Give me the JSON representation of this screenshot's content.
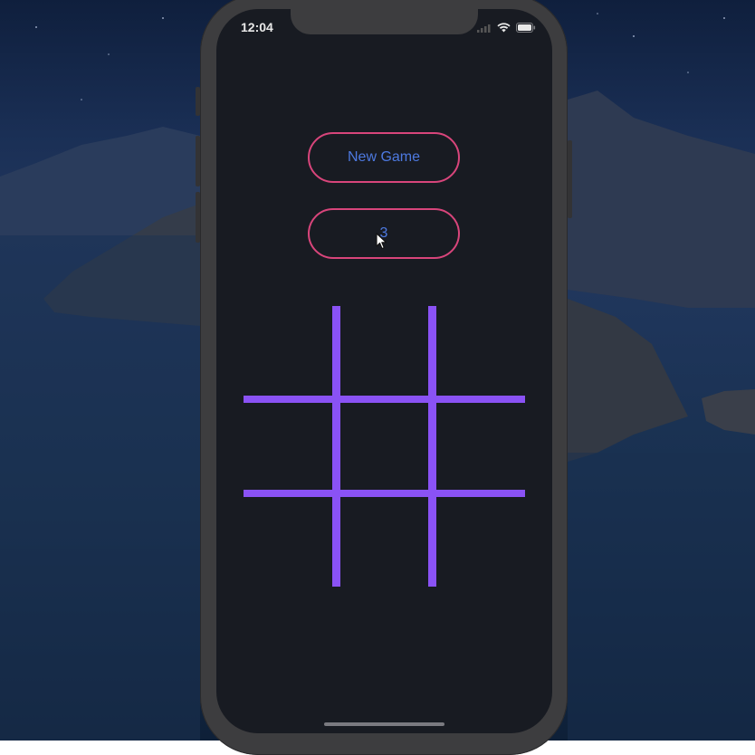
{
  "status_bar": {
    "time": "12:04"
  },
  "buttons": {
    "new_game_label": "New Game",
    "score_label": "3"
  },
  "board": {
    "rows": 3,
    "cols": 3,
    "cells": [
      "",
      "",
      "",
      "",
      "",
      "",
      "",
      "",
      ""
    ]
  },
  "colors": {
    "grid_lines": "#8a52f5",
    "button_border": "#d8457b",
    "button_text": "#4d79e0",
    "screen_background": "#181b22"
  },
  "icons": [
    "signal-icon",
    "wifi-icon",
    "battery-icon",
    "cursor-icon"
  ]
}
